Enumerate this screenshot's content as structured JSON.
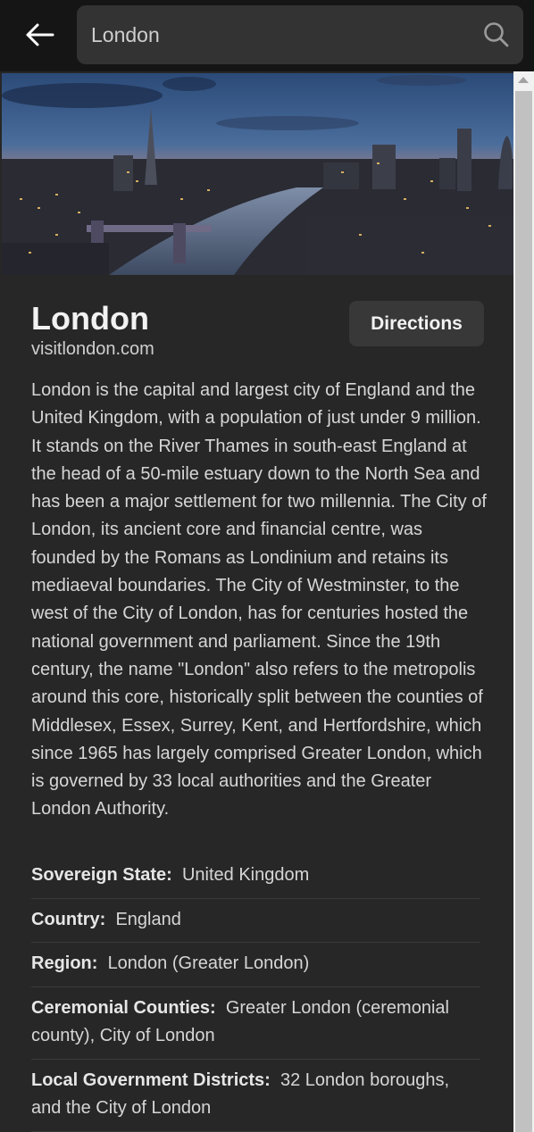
{
  "search": {
    "value": "London",
    "placeholder": "Search"
  },
  "place": {
    "title": "London",
    "website": "visitlondon.com",
    "directions_label": "Directions",
    "description": "London is the capital and largest city of England and the United Kingdom, with a population of just under 9 million. It stands on the River Thames in south-east England at the head of a 50-mile estuary down to the North Sea and has been a major settlement for two millennia. The City of London, its ancient core and financial centre, was founded by the Romans as Londinium and retains its mediaeval boundaries. The City of Westminster, to the west of the City of London, has for centuries hosted the national government and parliament. Since the 19th century, the name \"London\" also refers to the metropolis around this core, historically split between the counties of Middlesex, Essex, Surrey, Kent, and Hertfordshire, which since 1965 has largely comprised Greater London, which is governed by 33 local authorities and the Greater London Authority.",
    "facts": [
      {
        "label": "Sovereign State:",
        "value": "United Kingdom"
      },
      {
        "label": "Country:",
        "value": "England"
      },
      {
        "label": "Region:",
        "value": "London (Greater London)"
      },
      {
        "label": "Ceremonial Counties:",
        "value": "Greater London (ceremonial county), City of London"
      },
      {
        "label": "Local Government Districts:",
        "value": "32 London boroughs, and the City of London"
      }
    ]
  },
  "icons": {
    "back": "arrow-left-icon",
    "search": "search-icon"
  },
  "colors": {
    "background": "#272727",
    "topbar": "#151515",
    "search_box": "#333333",
    "button": "#383838"
  }
}
